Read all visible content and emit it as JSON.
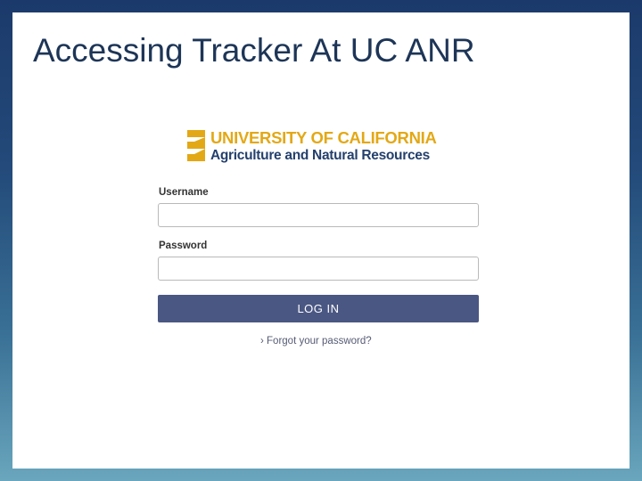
{
  "slide": {
    "title": "Accessing Tracker At UC ANR"
  },
  "logo": {
    "line1": "UNIVERSITY OF CALIFORNIA",
    "line2": "Agriculture and Natural Resources",
    "icon": "uc-anr-logo-mark",
    "colors": {
      "primary": "#e3a816",
      "secondary": "#24406d"
    }
  },
  "login_form": {
    "username_label": "Username",
    "username_value": "",
    "password_label": "Password",
    "password_value": "",
    "login_button": "LOG IN",
    "forgot_link": "› Forgot your password?",
    "button_color": "#4a5783"
  }
}
